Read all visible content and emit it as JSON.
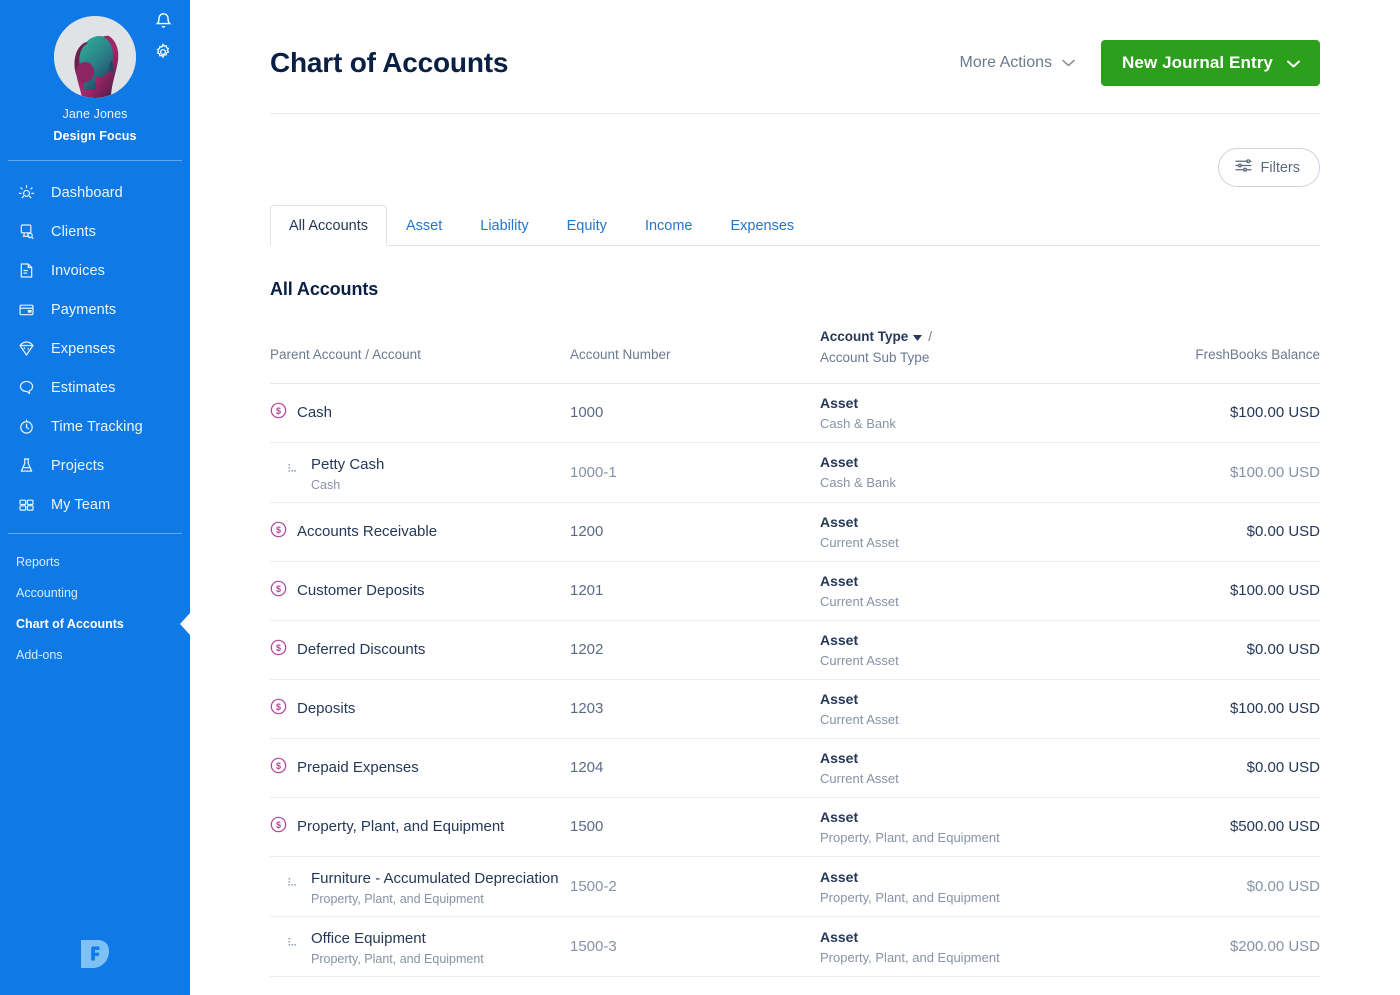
{
  "sidebar": {
    "user_name": "Jane Jones",
    "business_name": "Design Focus",
    "notification_icon": "bell-icon",
    "settings_icon": "gear-icon",
    "avatar_alt": "avatar",
    "nav": [
      {
        "label": "Dashboard",
        "icon": "dashboard-icon"
      },
      {
        "label": "Clients",
        "icon": "clients-icon"
      },
      {
        "label": "Invoices",
        "icon": "invoices-icon"
      },
      {
        "label": "Payments",
        "icon": "payments-icon"
      },
      {
        "label": "Expenses",
        "icon": "expenses-icon"
      },
      {
        "label": "Estimates",
        "icon": "estimates-icon"
      },
      {
        "label": "Time Tracking",
        "icon": "time-tracking-icon"
      },
      {
        "label": "Projects",
        "icon": "projects-icon"
      },
      {
        "label": "My Team",
        "icon": "my-team-icon"
      }
    ],
    "sub_nav": [
      {
        "label": "Reports",
        "active": false
      },
      {
        "label": "Accounting",
        "active": false
      },
      {
        "label": "Chart of Accounts",
        "active": true
      },
      {
        "label": "Add-ons",
        "active": false
      }
    ],
    "logo": "freshbooks-logo"
  },
  "header": {
    "title": "Chart of Accounts",
    "more_actions_label": "More Actions",
    "primary_button_label": "New Journal Entry",
    "chevron_icon": "chevron-down-icon"
  },
  "toolbar": {
    "filters_label": "Filters",
    "filters_icon": "sliders-icon"
  },
  "tabs": [
    {
      "label": "All Accounts",
      "active": true
    },
    {
      "label": "Asset",
      "active": false
    },
    {
      "label": "Liability",
      "active": false
    },
    {
      "label": "Equity",
      "active": false
    },
    {
      "label": "Income",
      "active": false
    },
    {
      "label": "Expenses",
      "active": false
    }
  ],
  "section": {
    "title": "All Accounts"
  },
  "table": {
    "headers": {
      "name": "Parent Account / Account",
      "number": "Account Number",
      "type_main": "Account Type",
      "type_slash": "/",
      "type_sub": "Account Sub Type",
      "balance": "FreshBooks Balance",
      "sort_icon": "caret-down-icon"
    },
    "rows": [
      {
        "name": "Cash",
        "parent": "",
        "number": "1000",
        "type": "Asset",
        "sub_type": "Cash & Bank",
        "balance": "$100.00 USD",
        "child": false
      },
      {
        "name": "Petty Cash",
        "parent": "Cash",
        "number": "1000-1",
        "type": "Asset",
        "sub_type": "Cash & Bank",
        "balance": "$100.00 USD",
        "child": true
      },
      {
        "name": "Accounts Receivable",
        "parent": "",
        "number": "1200",
        "type": "Asset",
        "sub_type": "Current Asset",
        "balance": "$0.00 USD",
        "child": false
      },
      {
        "name": "Customer Deposits",
        "parent": "",
        "number": "1201",
        "type": "Asset",
        "sub_type": "Current Asset",
        "balance": "$100.00 USD",
        "child": false
      },
      {
        "name": "Deferred Discounts",
        "parent": "",
        "number": "1202",
        "type": "Asset",
        "sub_type": "Current Asset",
        "balance": "$0.00 USD",
        "child": false
      },
      {
        "name": "Deposits",
        "parent": "",
        "number": "1203",
        "type": "Asset",
        "sub_type": "Current Asset",
        "balance": "$100.00 USD",
        "child": false
      },
      {
        "name": "Prepaid Expenses",
        "parent": "",
        "number": "1204",
        "type": "Asset",
        "sub_type": "Current Asset",
        "balance": "$0.00 USD",
        "child": false
      },
      {
        "name": "Property, Plant, and Equipment",
        "parent": "",
        "number": "1500",
        "type": "Asset",
        "sub_type": "Property, Plant, and Equipment",
        "balance": "$500.00 USD",
        "child": false
      },
      {
        "name": "Furniture - Accumulated Depreciation",
        "parent": "Property, Plant, and Equipment",
        "number": "1500-2",
        "type": "Asset",
        "sub_type": "Property, Plant, and Equipment",
        "balance": "$0.00 USD",
        "child": true
      },
      {
        "name": "Office Equipment",
        "parent": "Property, Plant, and Equipment",
        "number": "1500-3",
        "type": "Asset",
        "sub_type": "Property, Plant, and Equipment",
        "balance": "$200.00 USD",
        "child": true
      }
    ]
  },
  "colors": {
    "sidebar_blue": "#0f7ae5",
    "primary_green": "#2ca01c",
    "link_blue": "#2277cc",
    "accent_magenta": "#b3479b",
    "text_dark": "#253858"
  }
}
